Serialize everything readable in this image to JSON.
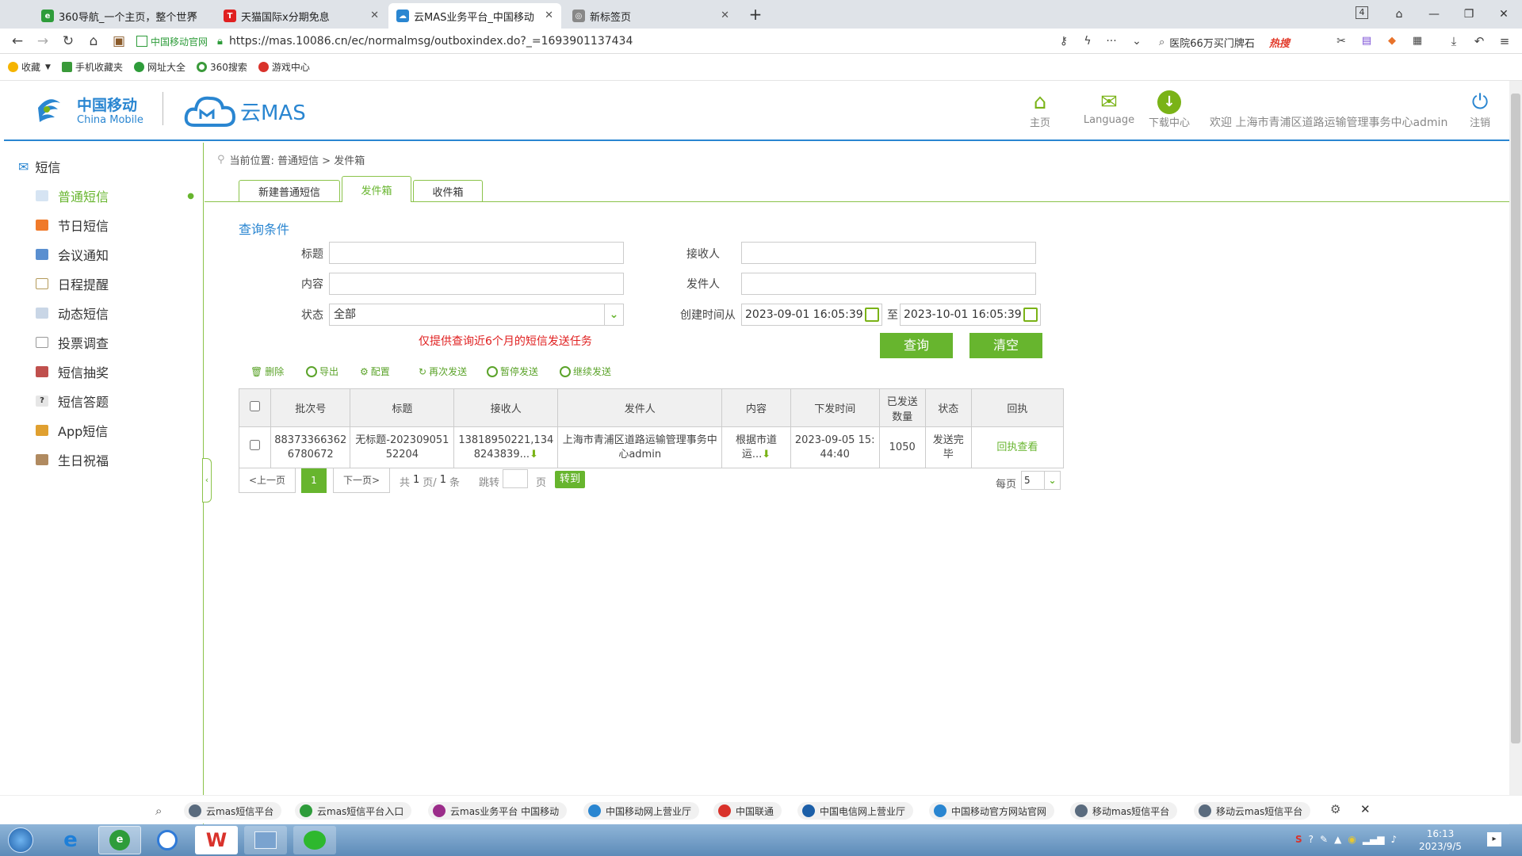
{
  "browser": {
    "tabs": [
      {
        "title": "360导航_一个主页，整个世界",
        "icon_color": "#2e9c3a"
      },
      {
        "title": "天猫国际x分期免息",
        "icon_color": "#e02020"
      },
      {
        "title": "云MAS业务平台_中国移动",
        "icon_color": "#2a86d1"
      },
      {
        "title": "新标签页",
        "icon_color": "#888888"
      }
    ],
    "tab_count_badge": "4",
    "verified_label": "中国移动官网",
    "url": "https://mas.10086.cn/ec/normalmsg/outboxindex.do?_=1693901137434",
    "search_hint": "医院66万买门牌石",
    "hot_label": "热搜"
  },
  "bookmarks": [
    {
      "label": "收藏",
      "color": "#f5b400"
    },
    {
      "label": "手机收藏夹",
      "color": "#3a9a3a"
    },
    {
      "label": "网址大全",
      "color": "#2e9c3a"
    },
    {
      "label": "360搜索",
      "color": "#3a9a3a"
    },
    {
      "label": "游戏中心",
      "color": "#d9322b"
    }
  ],
  "header": {
    "logo_cn": "中国移动",
    "logo_en": "China Mobile",
    "product": "云MAS",
    "nav": [
      {
        "label": "主页"
      },
      {
        "label": "Language"
      },
      {
        "label": "下载中心"
      }
    ],
    "welcome": "欢迎 上海市青浦区道路运输管理事务中心admin",
    "logout": "注销"
  },
  "sidebar": {
    "title": "短信",
    "items": [
      {
        "label": "普通短信",
        "active": true
      },
      {
        "label": "节日短信"
      },
      {
        "label": "会议通知"
      },
      {
        "label": "日程提醒"
      },
      {
        "label": "动态短信"
      },
      {
        "label": "投票调查"
      },
      {
        "label": "短信抽奖"
      },
      {
        "label": "短信答题"
      },
      {
        "label": "App短信"
      },
      {
        "label": "生日祝福"
      }
    ]
  },
  "main": {
    "breadcrumb": "当前位置: 普通短信 > 发件箱",
    "tabs": [
      {
        "label": "新建普通短信"
      },
      {
        "label": "发件箱",
        "active": true
      },
      {
        "label": "收件箱"
      }
    ],
    "query_title": "查询条件",
    "labels": {
      "title": "标题",
      "content": "内容",
      "status": "状态",
      "receiver": "接收人",
      "sender": "发件人",
      "created_from": "创建时间从",
      "to": "至"
    },
    "status_value": "全部",
    "date_from": "2023-09-01 16:05:39",
    "date_to": "2023-10-01 16:05:39",
    "notice": "仅提供查询近6个月的短信发送任务",
    "query_btn": "查询",
    "clear_btn": "清空",
    "toolbar": [
      "删除",
      "导出",
      "配置",
      "再次发送",
      "暂停发送",
      "继续发送"
    ],
    "table": {
      "headers": [
        "批次号",
        "标题",
        "接收人",
        "发件人",
        "内容",
        "下发时间",
        "已发送数量",
        "状态",
        "回执"
      ],
      "rows": [
        {
          "batch": "883733663626780672",
          "title": "无标题-20230905152204",
          "receiver": "13818950221,1348243839...",
          "sender": "上海市青浦区道路运输管理事务中心admin",
          "content": "根据市道运...",
          "time": "2023-09-05 15:44:40",
          "sent": "1050",
          "status": "发送完毕",
          "receipt": "回执查看"
        }
      ]
    },
    "pager": {
      "prev": "<上一页",
      "current": "1",
      "next": "下一页>",
      "summary_pre": "共",
      "pages": "1",
      "summary_mid": "页/",
      "total": "1",
      "summary_post": "条",
      "jump": "跳转",
      "page_unit": "页",
      "go": "转到",
      "per_page_label": "每页",
      "per_page": "5"
    }
  },
  "shortcuts": [
    {
      "label": "云mas短信平台",
      "color": "#5a6b7e"
    },
    {
      "label": "云mas短信平台入口",
      "color": "#2e9c3a"
    },
    {
      "label": "云mas业务平台 中国移动",
      "color": "#9b2d8a"
    },
    {
      "label": "中国移动网上营业厅",
      "color": "#2a86d1"
    },
    {
      "label": "中国联通",
      "color": "#d9322b"
    },
    {
      "label": "中国电信网上营业厅",
      "color": "#1c5fa8"
    },
    {
      "label": "中国移动官方网站官网",
      "color": "#2a86d1"
    },
    {
      "label": "移动mas短信平台",
      "color": "#5a6b7e"
    },
    {
      "label": "移动云mas短信平台",
      "color": "#5a6b7e"
    }
  ],
  "taskbar": {
    "time": "16:13",
    "date": "2023/9/5"
  }
}
